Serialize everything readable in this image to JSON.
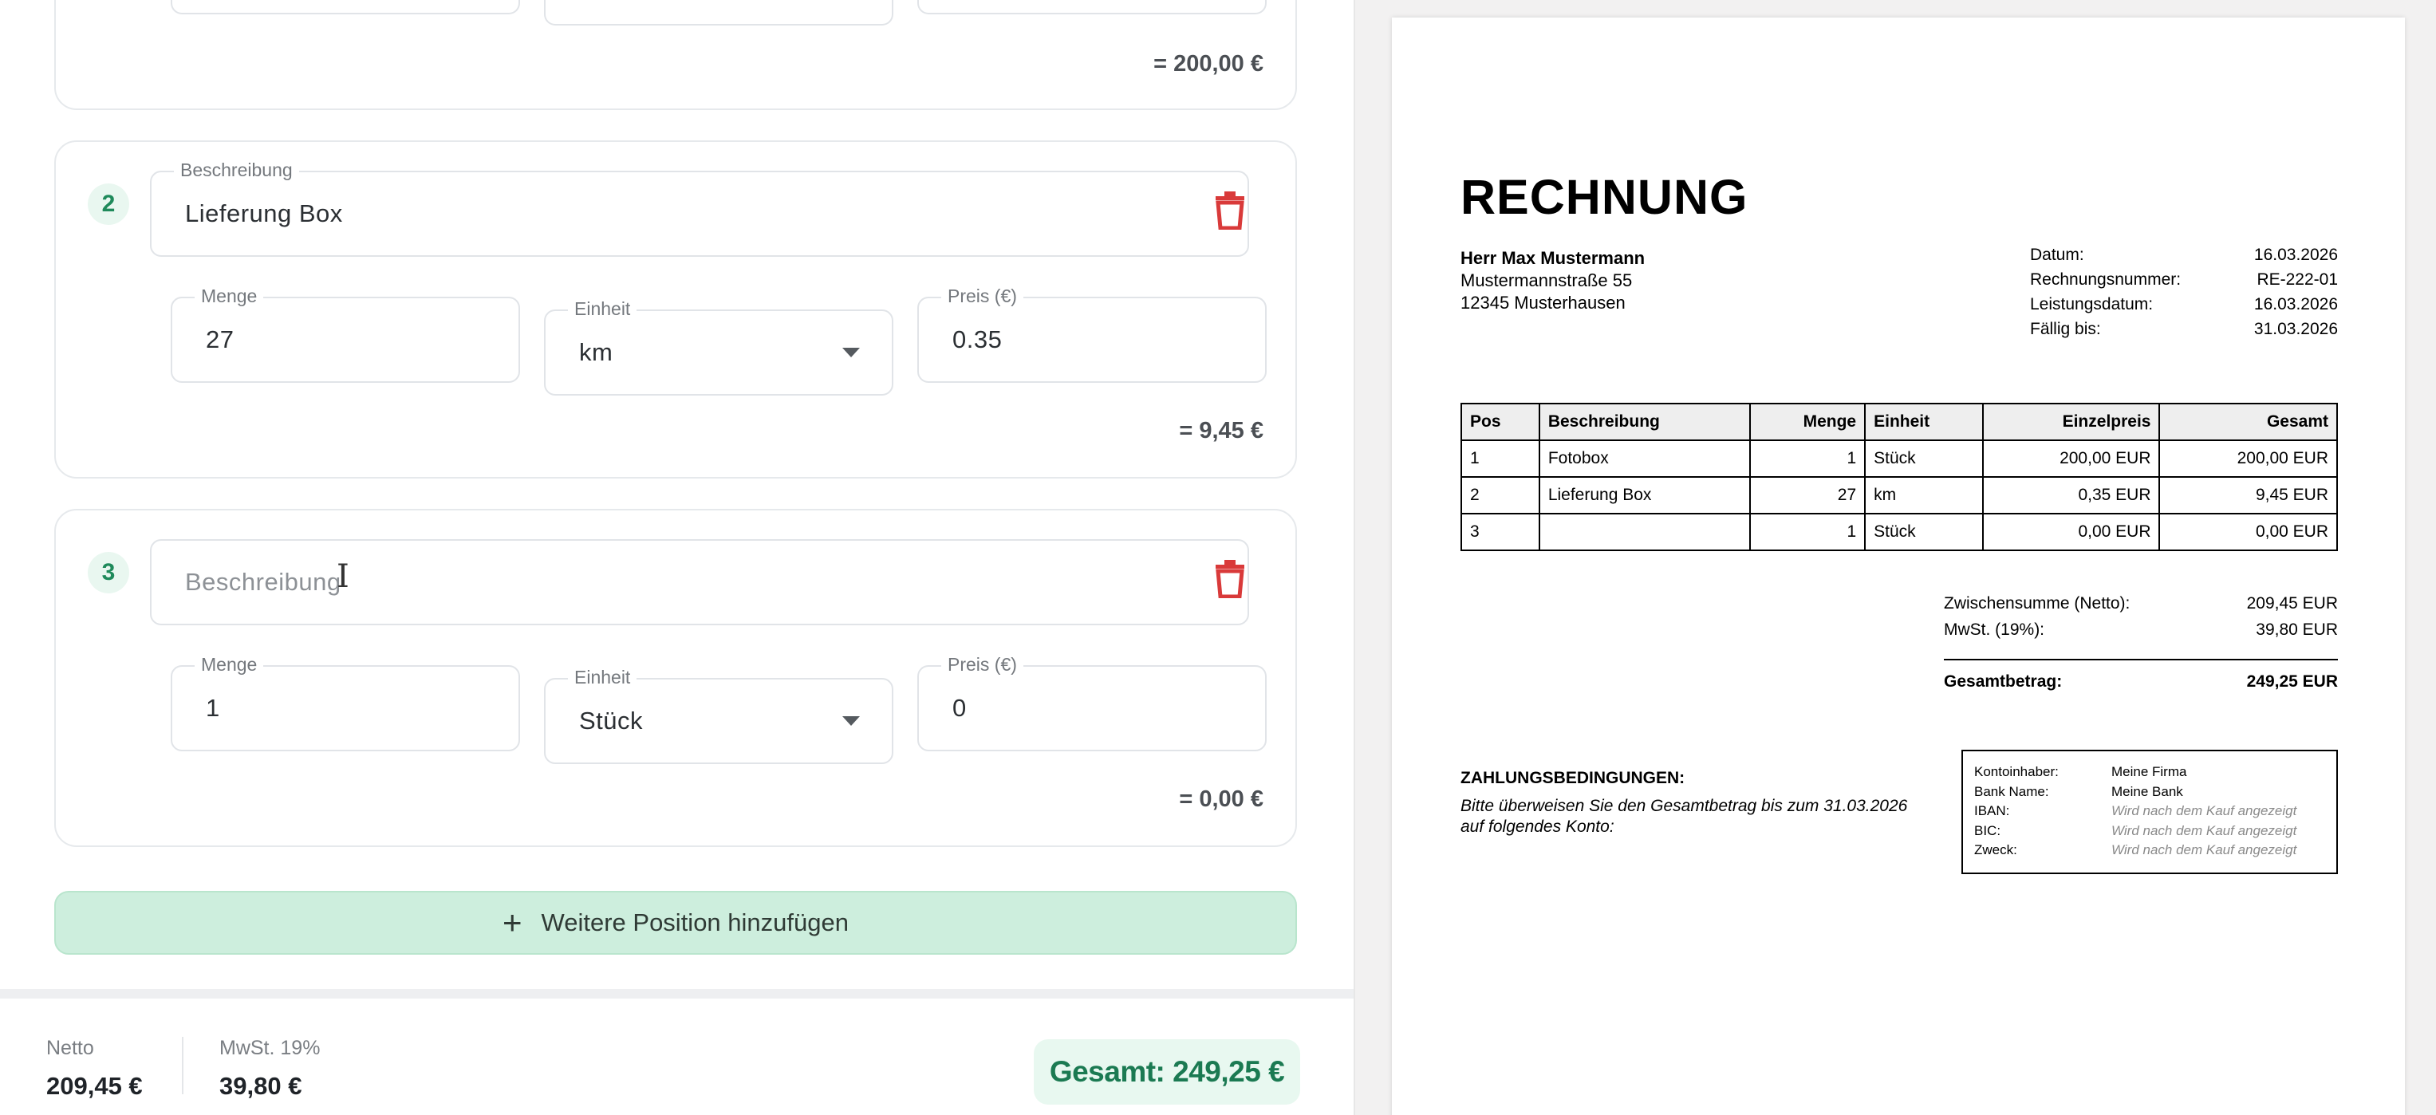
{
  "editor": {
    "top_card": {
      "line_total": "= 200,00 €"
    },
    "positions": [
      {
        "number": "2",
        "description_label": "Beschreibung",
        "description_value": "Lieferung Box",
        "description_placeholder": "",
        "quantity_label": "Menge",
        "quantity_value": "27",
        "unit_label": "Einheit",
        "unit_value": "km",
        "price_label": "Preis (€)",
        "price_value": "0.35",
        "line_total": "= 9,45 €"
      },
      {
        "number": "3",
        "description_label": "",
        "description_value": "",
        "description_placeholder": "Beschreibung",
        "quantity_label": "Menge",
        "quantity_value": "1",
        "unit_label": "Einheit",
        "unit_value": "Stück",
        "price_label": "Preis (€)",
        "price_value": "0",
        "line_total": "= 0,00 €"
      }
    ],
    "add_button_label": "Weitere Position hinzufügen",
    "add_button_icon": "plus-icon",
    "delete_icon": "trash-icon"
  },
  "footer": {
    "netto_label": "Netto",
    "netto_value": "209,45 €",
    "mwst_label": "MwSt. 19%",
    "mwst_value": "39,80 €",
    "total_label": "Gesamt: 249,25 €"
  },
  "preview": {
    "title": "RECHNUNG",
    "recipient": {
      "name": "Herr Max Mustermann",
      "street": "Mustermannstraße 55",
      "city": "12345 Musterhausen"
    },
    "meta": [
      {
        "label": "Datum:",
        "value": "16.03.2026"
      },
      {
        "label": "Rechnungsnummer:",
        "value": "RE-222-01"
      },
      {
        "label": "Leistungsdatum:",
        "value": "16.03.2026"
      },
      {
        "label": "Fällig bis:",
        "value": "31.03.2026"
      }
    ],
    "table": {
      "headers": [
        "Pos",
        "Beschreibung",
        "Menge",
        "Einheit",
        "Einzelpreis",
        "Gesamt"
      ],
      "rows": [
        [
          "1",
          "Fotobox",
          "1",
          "Stück",
          "200,00 EUR",
          "200,00 EUR"
        ],
        [
          "2",
          "Lieferung Box",
          "27",
          "km",
          "0,35 EUR",
          "9,45 EUR"
        ],
        [
          "3",
          "",
          "1",
          "Stück",
          "0,00 EUR",
          "0,00 EUR"
        ]
      ]
    },
    "sums": {
      "subtotal_label": "Zwischensumme (Netto):",
      "subtotal_value": "209,45 EUR",
      "tax_label": "MwSt. (19%):",
      "tax_value": "39,80 EUR",
      "grand_label": "Gesamtbetrag:",
      "grand_value": "249,25 EUR"
    },
    "payment": {
      "heading": "ZAHLUNGSBEDINGUNGEN:",
      "line1": "Bitte überweisen Sie den Gesamtbetrag bis zum 31.03.2026",
      "line2": "auf folgendes Konto:"
    },
    "bank": [
      {
        "label": "Kontoinhaber:",
        "value": "Meine Firma",
        "muted": false
      },
      {
        "label": "Bank Name:",
        "value": "Meine Bank",
        "muted": false
      },
      {
        "label": "IBAN:",
        "value": "Wird nach dem Kauf angezeigt",
        "muted": true
      },
      {
        "label": "BIC:",
        "value": "Wird nach dem Kauf angezeigt",
        "muted": true
      },
      {
        "label": "Zweck:",
        "value": "Wird nach dem Kauf angezeigt",
        "muted": true
      }
    ]
  },
  "colors": {
    "accent": "#1b7a52",
    "accent_bg": "#e8f8f0",
    "add_button_bg": "#cdeedd",
    "delete": "#d93a3a"
  }
}
